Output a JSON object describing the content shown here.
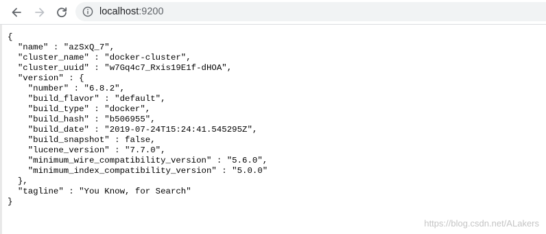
{
  "browser": {
    "url_host": "localhost",
    "url_port": ":9200",
    "icons": {
      "back": "back-arrow-icon",
      "forward": "forward-arrow-icon",
      "reload": "reload-icon",
      "site_info": "info-icon"
    }
  },
  "response": {
    "lines": [
      "{",
      "  \"name\" : \"azSxQ_7\",",
      "  \"cluster_name\" : \"docker-cluster\",",
      "  \"cluster_uuid\" : \"w7Gq4c7_Rxis19E1f-dHOA\",",
      "  \"version\" : {",
      "    \"number\" : \"6.8.2\",",
      "    \"build_flavor\" : \"default\",",
      "    \"build_type\" : \"docker\",",
      "    \"build_hash\" : \"b506955\",",
      "    \"build_date\" : \"2019-07-24T15:24:41.545295Z\",",
      "    \"build_snapshot\" : false,",
      "    \"lucene_version\" : \"7.7.0\",",
      "    \"minimum_wire_compatibility_version\" : \"5.6.0\",",
      "    \"minimum_index_compatibility_version\" : \"5.0.0\"",
      "  },",
      "  \"tagline\" : \"You Know, for Search\"",
      "}"
    ]
  },
  "watermark": "https://blog.csdn.net/ALakers",
  "colors": {
    "toolbar_bg": "#ffffff",
    "omnibox_bg": "#f1f3f4",
    "icon": "#5f6368",
    "disabled_icon": "#bdc1c6",
    "text": "#000000"
  }
}
